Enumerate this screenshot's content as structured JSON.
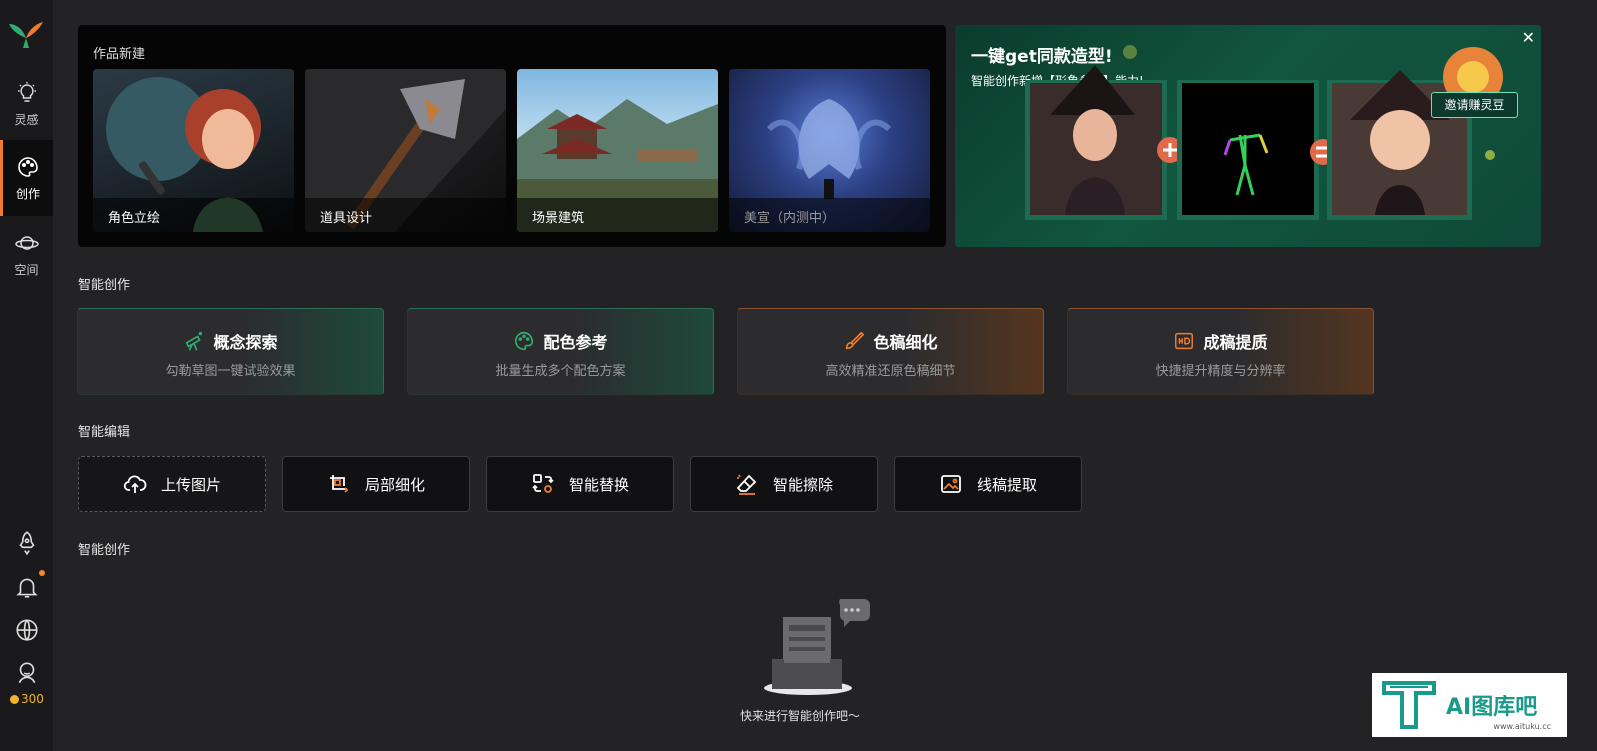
{
  "sidebar": {
    "items": [
      {
        "label": "灵感",
        "icon": "lightbulb-icon"
      },
      {
        "label": "创作",
        "icon": "palette-icon"
      },
      {
        "label": "空间",
        "icon": "planet-icon"
      }
    ],
    "bottom_icons": [
      "rocket-icon",
      "bell-icon",
      "globe-icon",
      "user-icon"
    ],
    "coins": "300"
  },
  "works": {
    "title": "作品新建",
    "cards": [
      {
        "label": "角色立绘"
      },
      {
        "label": "道具设计"
      },
      {
        "label": "场景建筑"
      },
      {
        "label": "美宣（内测中）"
      }
    ]
  },
  "banner": {
    "title": "一键get同款造型!",
    "subtitle": "智能创作新增【形象参考】能力!",
    "invite_label": "邀请赚灵豆",
    "close_label": "✕"
  },
  "ai_create": {
    "section_title": "智能创作",
    "cards": [
      {
        "title": "概念探索",
        "subtitle": "勾勒草图一键试验效果",
        "icon": "telescope-icon"
      },
      {
        "title": "配色参考",
        "subtitle": "批量生成多个配色方案",
        "icon": "palette-icon"
      },
      {
        "title": "色稿细化",
        "subtitle": "高效精准还原色稿细节",
        "icon": "brush-icon"
      },
      {
        "title": "成稿提质",
        "subtitle": "快捷提升精度与分辨率",
        "icon": "hd-icon"
      }
    ]
  },
  "ai_edit": {
    "section_title": "智能编辑",
    "buttons": [
      {
        "label": "上传图片",
        "icon": "upload-cloud-icon"
      },
      {
        "label": "局部细化",
        "icon": "crop-refine-icon"
      },
      {
        "label": "智能替换",
        "icon": "swap-icon"
      },
      {
        "label": "智能擦除",
        "icon": "eraser-icon"
      },
      {
        "label": "线稿提取",
        "icon": "image-icon"
      }
    ]
  },
  "history": {
    "section_title": "智能创作",
    "empty_text": "快来进行智能创作吧～"
  },
  "watermark": {
    "name": "AI图库吧",
    "url": "www.aituku.cc"
  },
  "colors": {
    "accent_orange": "#f07c2f",
    "accent_green": "#2e6d55",
    "bg": "#232325"
  }
}
